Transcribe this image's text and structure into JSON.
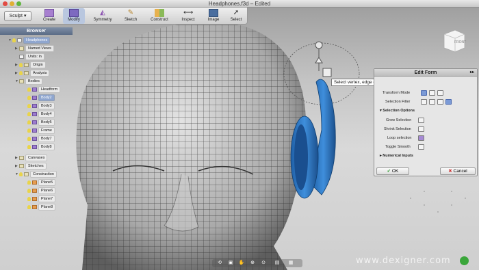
{
  "window": {
    "title": "Headphones.f3d – Edited"
  },
  "toolbar": {
    "workspace": "Sculpt",
    "items": [
      {
        "label": "Create",
        "icon": "cube-icon"
      },
      {
        "label": "Modify",
        "icon": "modify-icon"
      },
      {
        "label": "Symmetry",
        "icon": "symmetry-icon"
      },
      {
        "label": "Sketch",
        "icon": "pencil-icon"
      },
      {
        "label": "Construct",
        "icon": "construct-icon"
      },
      {
        "label": "Inspect",
        "icon": "ruler-icon"
      },
      {
        "label": "Image",
        "icon": "picture-icon"
      },
      {
        "label": "Select",
        "icon": "cursor-icon"
      }
    ]
  },
  "browser": {
    "title": "Browser",
    "root": "Headphones",
    "named_views": "Named Views",
    "units": "Units: in",
    "origin": "Origin",
    "analysis": "Analysis",
    "bodies": "Bodies",
    "body_items": [
      "Headform",
      "Body2",
      "Body3",
      "Body4",
      "Body5",
      "Frame",
      "Body7",
      "Body8"
    ],
    "canvases": "Canvases",
    "sketches": "Sketches",
    "construction": "Construction",
    "planes": [
      "Plane5",
      "Plane6",
      "Plane7",
      "Plane8"
    ]
  },
  "edit_form": {
    "title": "Edit Form",
    "transform_mode": "Transform Mode",
    "selection_filter": "Selection Filter",
    "selection_options": "Selection Options",
    "grow_selection": "Grow Selection",
    "shrink_selection": "Shrink Selection",
    "loop_selection": "Loop selection",
    "toggle_smooth": "Toggle Smooth",
    "numerical_inputs": "Numerical Inputs",
    "ok": "OK",
    "cancel": "Cancel"
  },
  "tooltip": "Select vertex, edge or face for transform, Alt key to extrude",
  "viewcube": {
    "face": "FRONT"
  },
  "watermark": "www.dexigner.com"
}
